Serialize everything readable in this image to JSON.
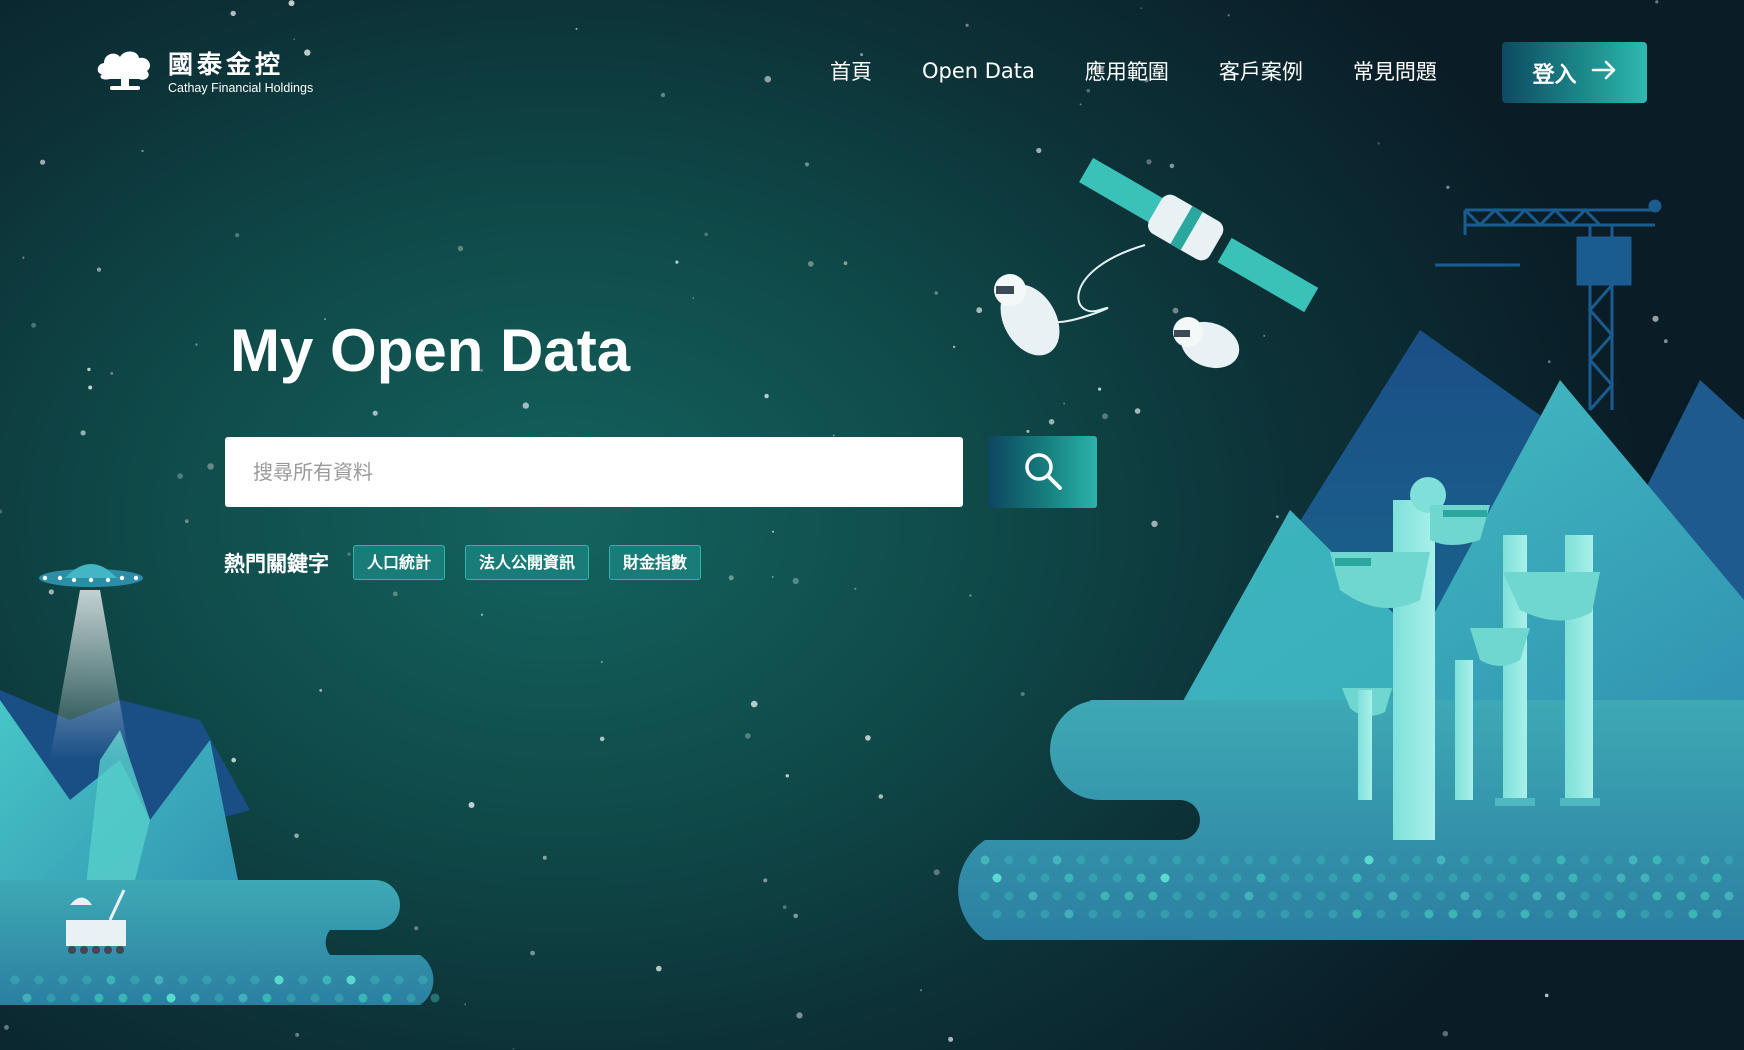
{
  "brand": {
    "name_cn": "國泰金控",
    "name_en": "Cathay Financial Holdings",
    "icon": "tree-logo-icon"
  },
  "nav": {
    "items": [
      {
        "label": "首頁"
      },
      {
        "label": "Open Data"
      },
      {
        "label": "應用範圍"
      },
      {
        "label": "客戶案例"
      },
      {
        "label": "常見問題"
      }
    ],
    "login_label": "登入",
    "login_icon": "arrow-right-icon"
  },
  "hero": {
    "title": "My Open Data",
    "search_placeholder": "搜尋所有資料",
    "search_value": "",
    "search_icon": "search-icon"
  },
  "keywords": {
    "label": "熱門關鍵字",
    "tags": [
      "人口統計",
      "法人公開資訊",
      "財金指數"
    ]
  },
  "colors": {
    "accent": "#2fb9b0",
    "background_dark": "#0a1c26",
    "background_teal": "#14635f"
  }
}
